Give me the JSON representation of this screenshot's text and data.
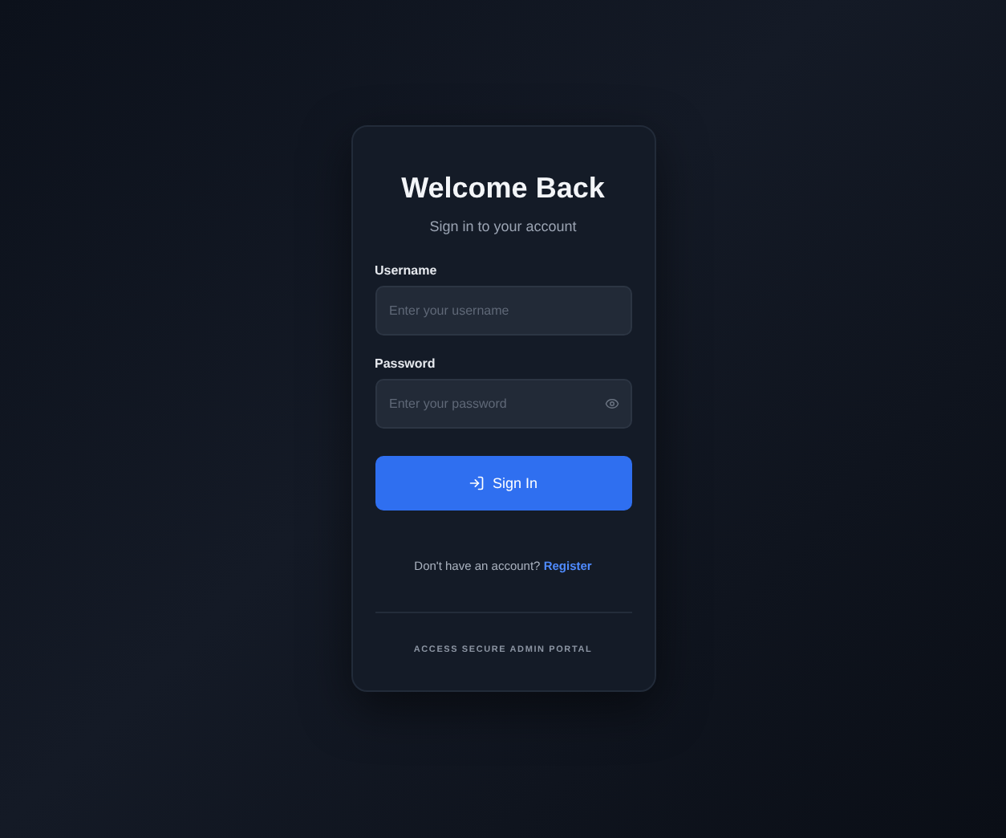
{
  "title": "Welcome Back",
  "subtitle": "Sign in to your account",
  "fields": [
    {
      "label": "Username",
      "placeholder": "Enter your username",
      "kind": "text"
    },
    {
      "label": "Password",
      "placeholder": "Enter your password",
      "kind": "password"
    }
  ],
  "submit": "Sign In",
  "register": {
    "prompt": "Don't have an account?",
    "link": "Register"
  },
  "footer": "ACCESS SECURE ADMIN PORTAL"
}
